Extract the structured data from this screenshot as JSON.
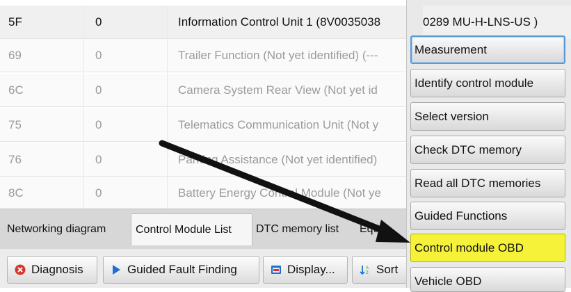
{
  "table": {
    "rows": [
      {
        "address": "5F",
        "value": "0",
        "name": "Information Control Unit 1 (8V0035038",
        "state": "sel"
      },
      {
        "address": "69",
        "value": "0",
        "name": "Trailer Function (Not yet identified) (---",
        "state": "dim"
      },
      {
        "address": "6C",
        "value": "0",
        "name": "Camera System Rear View (Not yet id",
        "state": "dim"
      },
      {
        "address": "75",
        "value": "0",
        "name": "Telematics Communication Unit (Not y",
        "state": "dim"
      },
      {
        "address": "76",
        "value": "0",
        "name": "Parking Assistance (Not yet identified)",
        "state": "dim"
      },
      {
        "address": "8C",
        "value": "0",
        "name": "Battery Energy Control Module (Not ye",
        "state": "dim"
      }
    ],
    "selected_row_tail": "0289  MU-H-LNS-US  )"
  },
  "tabs": [
    {
      "label": "Networking diagram",
      "active": false
    },
    {
      "label": "Control Module List",
      "active": true
    },
    {
      "label": "DTC memory list",
      "active": false
    },
    {
      "label": "Equ",
      "active": false
    }
  ],
  "bottom_buttons": [
    {
      "label": "Diagnosis",
      "icon": "stop-x-icon"
    },
    {
      "label": "Guided Fault Finding",
      "icon": "play-triangle-icon"
    },
    {
      "label": "Display...",
      "icon": "display-window-icon"
    },
    {
      "label": "Sort",
      "icon": "sort-az-icon"
    }
  ],
  "menu": {
    "items": [
      {
        "label": "Measurement",
        "state": "focused"
      },
      {
        "label": "Identify control module",
        "state": "normal"
      },
      {
        "label": "Select version",
        "state": "normal"
      },
      {
        "label": "Check DTC memory",
        "state": "normal"
      },
      {
        "label": "Read all DTC memories",
        "state": "normal"
      },
      {
        "label": "Guided Functions",
        "state": "normal"
      },
      {
        "label": "Control module OBD",
        "state": "highlight"
      },
      {
        "label": "Vehicle OBD",
        "state": "normal"
      }
    ]
  },
  "colors": {
    "highlight": "#f6f23a",
    "focus_border": "#5b9bd5",
    "diagnosis_icon": "#d9352b",
    "guided_icon": "#1e6fd1",
    "display_icon": "#1e6fd1",
    "arrow": "#111111"
  }
}
